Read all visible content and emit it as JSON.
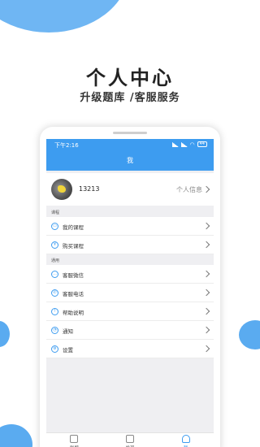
{
  "promo": {
    "title": "个人中心",
    "subtitle": "升级题库 /客服服务"
  },
  "status_bar": {
    "time": "下午2:16",
    "battery": "44"
  },
  "header": {
    "title": "我"
  },
  "profile": {
    "name": "13213",
    "info_link": "个人信息"
  },
  "sections": {
    "course_label": "课程",
    "general_label": "通用"
  },
  "course_items": [
    {
      "label": "我的课程",
      "icon": "book-icon"
    },
    {
      "label": "购买课程",
      "icon": "coin-icon"
    }
  ],
  "general_items": [
    {
      "label": "客服微信",
      "icon": "chat-icon"
    },
    {
      "label": "客服电话",
      "icon": "phone-icon"
    },
    {
      "label": "帮助说明",
      "icon": "info-icon"
    },
    {
      "label": "通知",
      "icon": "bell-icon"
    },
    {
      "label": "设置",
      "icon": "gear-icon"
    }
  ],
  "tabbar": [
    {
      "label": "刷题",
      "icon": "edit-icon"
    },
    {
      "label": "发现",
      "icon": "discover-icon"
    },
    {
      "label": "我",
      "icon": "person-icon",
      "active": true
    }
  ],
  "colors": {
    "accent": "#3d9cf0",
    "background": "#efeff2"
  }
}
